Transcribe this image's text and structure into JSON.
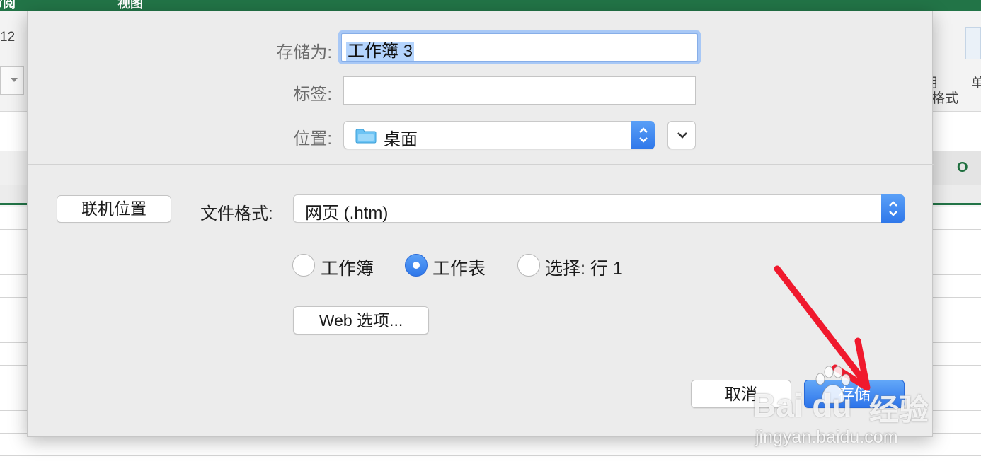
{
  "excel": {
    "ribbon_tabs": [
      "审阅",
      "视图"
    ],
    "font_size": "12",
    "ribbon_right_partial": [
      "用",
      "格式",
      "单"
    ],
    "column_header": "O"
  },
  "dialog": {
    "save_as_label": "存储为:",
    "save_as_value": "工作簿 3",
    "tags_label": "标签:",
    "tags_value": "",
    "location_label": "位置:",
    "location_value": "桌面",
    "online_locations_button": "联机位置",
    "file_format_label": "文件格式:",
    "file_format_value": "网页 (.htm)",
    "radio_options": [
      {
        "label": "工作簿",
        "selected": false
      },
      {
        "label": "工作表",
        "selected": true
      },
      {
        "label": "选择: 行 1",
        "selected": false
      }
    ],
    "web_options_button": "Web 选项...",
    "cancel_button": "取消",
    "save_button": "存储"
  },
  "watermark": {
    "logo": "Bai du",
    "brand": "经验",
    "url": "jingyan.baidu.com"
  },
  "colors": {
    "excel_green": "#227447",
    "accent_blue": "#2f78ea",
    "arrow_red": "#f0192d"
  },
  "icons": [
    "folder-icon",
    "stepper-icon",
    "chevron-down-icon",
    "red-arrow",
    "baidu-paw-icon"
  ]
}
